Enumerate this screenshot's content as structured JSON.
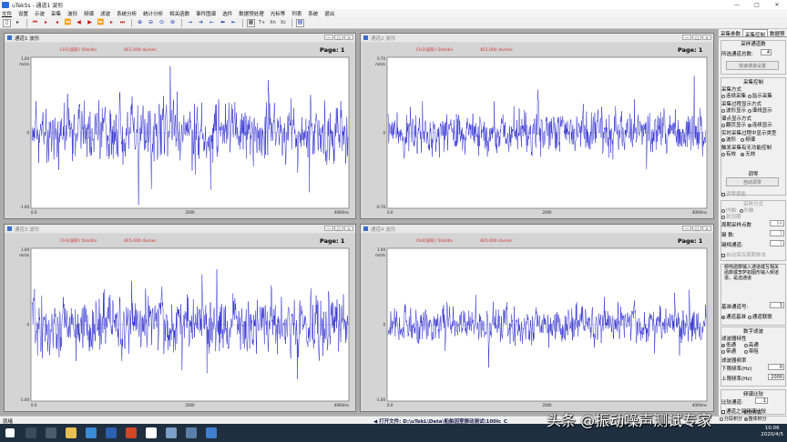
{
  "window": {
    "title": "uTekSs - 通道1 波形",
    "controls": [
      "—",
      "□",
      "✕"
    ]
  },
  "menu": [
    "文件",
    "设置",
    "示波",
    "采集",
    "波形",
    "频谱",
    "滤波",
    "系统分析",
    "统计分析",
    "相关函数",
    "事件图谱",
    "选件",
    "数据预处理",
    "光标等",
    "列表",
    "系统",
    "退出"
  ],
  "toolbar": {
    "labels": [
      "T+",
      "Xn",
      "Xc"
    ]
  },
  "plots": [
    {
      "title": "通道1 波形",
      "active": true,
      "page": "Page:  1",
      "hdr_left": "CH1(波形)  5Hz/div",
      "hdr_mid": "4E5.000 div/sec",
      "y_top_val": "1.00",
      "y_unit": "m/s/s",
      "y_mid": "0",
      "y_bot": "-1.00",
      "x_ticks": [
        "0.0",
        "2000",
        "4000ms"
      ],
      "amp": 1.0,
      "seed": 11
    },
    {
      "title": "通道2 波形",
      "active": false,
      "page": "Page:  1",
      "hdr_left": "CH2(波形)  5Hz/div",
      "hdr_mid": "4E5.000 div/sec",
      "y_top_val": "0.70",
      "y_unit": "m/s/s",
      "y_mid": "0",
      "y_bot": "-0.70",
      "x_ticks": [
        "0.0",
        "2000",
        "4000ms"
      ],
      "amp": 0.75,
      "seed": 23
    },
    {
      "title": "通道3 波形",
      "active": false,
      "page": "Page:  1",
      "hdr_left": "CH3(波形)  5Hz/div",
      "hdr_mid": "4E5.000 div/sec",
      "y_top_val": "1.00",
      "y_unit": "m/s/s",
      "y_mid": "0",
      "y_bot": "-1.00",
      "x_ticks": [
        "0.0",
        "2000",
        "4000ms"
      ],
      "amp": 0.95,
      "seed": 37
    },
    {
      "title": "通道4 波形",
      "active": false,
      "page": "Page:  1",
      "hdr_left": "CH4(波形)  5Hz/div",
      "hdr_mid": "4E5.000 div/sec",
      "y_top_val": "1.00",
      "y_unit": "m/s/s",
      "y_mid": "0",
      "y_bot": "-1.00",
      "x_ticks": [
        "0.0",
        "2000",
        "4000ms"
      ],
      "amp": 0.6,
      "seed": 53
    }
  ],
  "panel": {
    "tabs": [
      "采集参数",
      "采集控制",
      "数据预"
    ],
    "channel_group": "采样通道数",
    "channel_label": "所选通道总数:",
    "channel_value": "4",
    "quick_select_btn": "快速通道设置",
    "acq_control_group": "采集控制",
    "acq_mode_title": "采集方式",
    "acq_mode_opts": [
      "连续采集",
      "监示采集"
    ],
    "display_mode_title": "采集过程显示方式",
    "display_mode_opts": [
      "波形显示",
      "谱线显示"
    ],
    "scan_mode_title": "谱点显示方式",
    "scan_mode_opts": [
      "翻页显示",
      "连续显示"
    ],
    "realtime_title": "实时采集过程中显示类型",
    "realtime_opts": [
      "波形",
      "频谱"
    ],
    "trigger_title": "触发采集有无功能控制",
    "trigger_opts": [
      "有效",
      "无效"
    ],
    "adjust_group": "调零",
    "auto_zero_btn": "自动调零",
    "zero_check": "调零使能",
    "sampling_group": "采样方式",
    "sampling_opts": [
      "内触",
      "外触"
    ],
    "sampling_opt3": "软同期",
    "cycle_label": "周期采样点数",
    "cycle_value": "64",
    "count_label": "键  数:",
    "count_value": "1",
    "key_label": "键相通道:",
    "key_value": "1",
    "auto_hold": "自动保存周期样本",
    "freq_note": "频响函数输入通道或互相关函数或李萨如图形输入频道道，是选通道",
    "ref_label": "基准通道号:",
    "ref_value": "1",
    "ref_opts": [
      "通道基准",
      "通道联联"
    ],
    "filter_group": "数字滤波",
    "filter_type_title": "滤波器特性",
    "filter_types": [
      "低通",
      "高通",
      "带通",
      "带阻"
    ],
    "filter_freq_title": "滤波器频率",
    "low_label": "下限频率(Hz)",
    "low_value": "0",
    "high_label": "上限频率(Hz)",
    "high_value": "2000",
    "compare_group": "频谱比较",
    "compare_label": "比较通道:",
    "compare_value": "1",
    "compare_check": "通道之间频谱比较",
    "integral_group": "积分方式",
    "integral_opts": [
      "分段积分",
      "整体积分"
    ]
  },
  "status": {
    "left": "就绪",
    "file": "◀ 打开文件: D:\\uTekL\\Data\\船舶因室振动测试\\100Ic_C"
  },
  "taskbar": {
    "time": "10:06",
    "date": "2020/4/5"
  },
  "watermark": "头条 @振动噪声测试专家"
}
